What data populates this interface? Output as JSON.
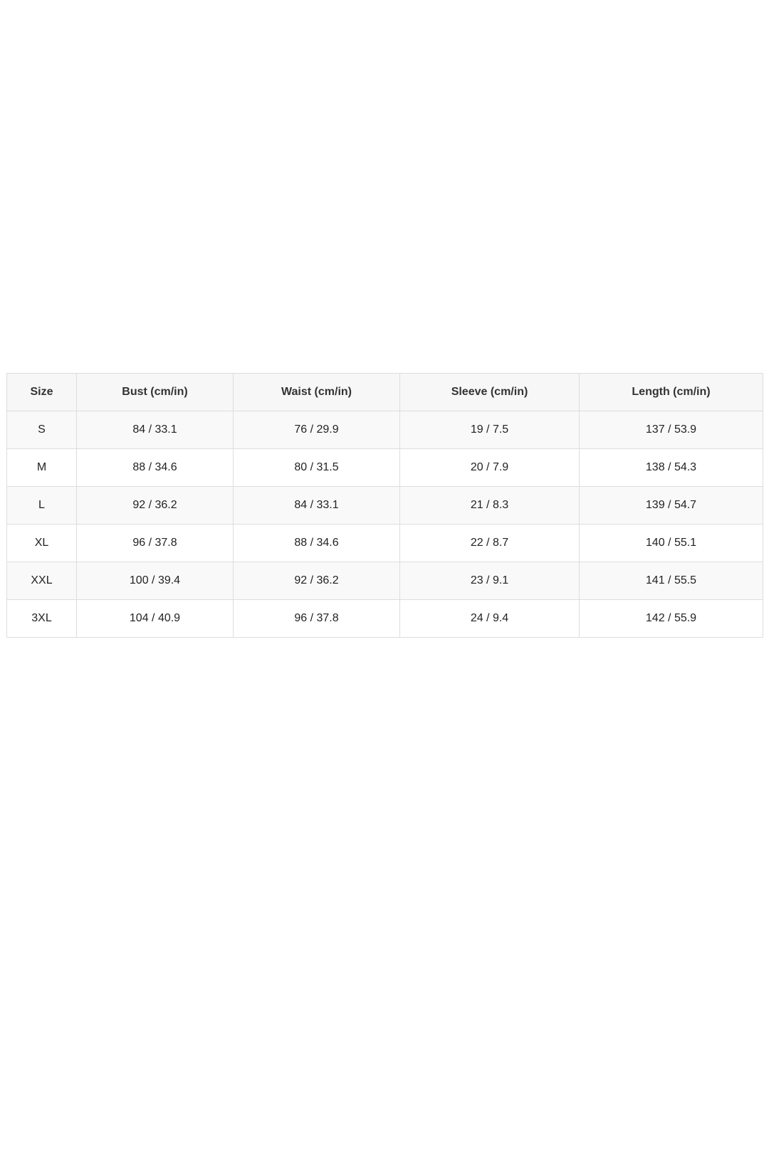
{
  "size_chart": {
    "headers": [
      "Size",
      "Bust (cm/in)",
      "Waist (cm/in)",
      "Sleeve (cm/in)",
      "Length (cm/in)"
    ],
    "rows": [
      [
        "S",
        "84 / 33.1",
        "76 / 29.9",
        "19 / 7.5",
        "137 / 53.9"
      ],
      [
        "M",
        "88 / 34.6",
        "80 / 31.5",
        "20 / 7.9",
        "138 / 54.3"
      ],
      [
        "L",
        "92 / 36.2",
        "84 / 33.1",
        "21 / 8.3",
        "139 / 54.7"
      ],
      [
        "XL",
        "96 / 37.8",
        "88 / 34.6",
        "22 / 8.7",
        "140 / 55.1"
      ],
      [
        "XXL",
        "100 / 39.4",
        "92 / 36.2",
        "23 / 9.1",
        "141 / 55.5"
      ],
      [
        "3XL",
        "104 / 40.9",
        "96 / 37.8",
        "24 / 9.4",
        "142 / 55.9"
      ]
    ]
  }
}
